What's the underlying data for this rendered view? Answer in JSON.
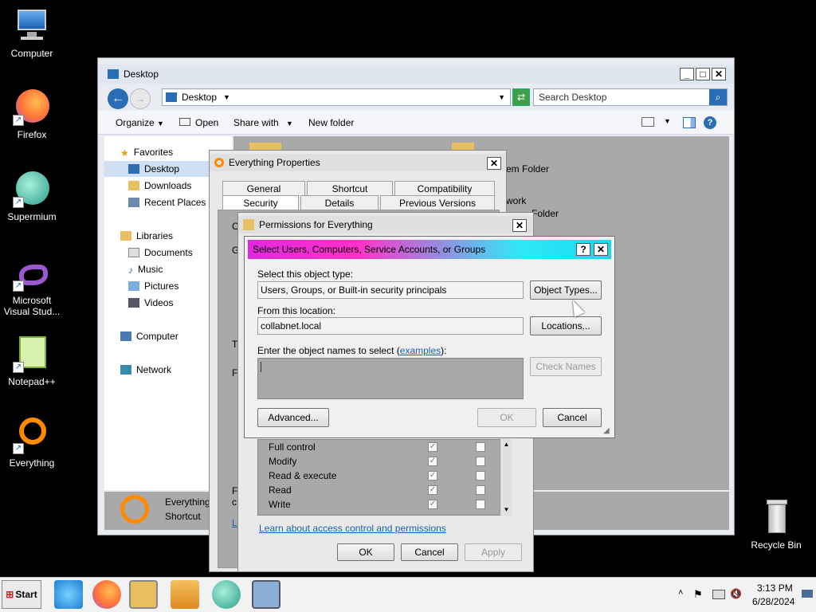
{
  "desktop": {
    "icons": [
      {
        "label": "Computer"
      },
      {
        "label": "Firefox"
      },
      {
        "label": "Supermium"
      },
      {
        "label": "Microsoft Visual Stud..."
      },
      {
        "label": "Notepad++"
      },
      {
        "label": "Everything"
      },
      {
        "label": "Recycle Bin"
      }
    ]
  },
  "explorer": {
    "title": "Desktop",
    "address": "Desktop",
    "search_placeholder": "Search Desktop",
    "toolbar": {
      "organize": "Organize",
      "open": "Open",
      "share_with": "Share with",
      "new_folder": "New folder"
    },
    "nav": {
      "favorites": "Favorites",
      "fav_items": [
        "Desktop",
        "Downloads",
        "Recent Places"
      ],
      "libraries": "Libraries",
      "lib_items": [
        "Documents",
        "Music",
        "Pictures",
        "Videos"
      ],
      "computer": "Computer",
      "network": "Network"
    },
    "content_fragments": [
      "em Folder",
      "work",
      "Folder"
    ],
    "details_name": "Everything",
    "details_type": "Shortcut"
  },
  "properties": {
    "title": "Everything Properties",
    "tabs_row1": [
      "General",
      "Shortcut",
      "Compatibility"
    ],
    "tabs_row2": [
      "Security",
      "Details",
      "Previous Versions"
    ],
    "frag_c": "C",
    "frag_g": "G",
    "frag_t": "T",
    "frag_f": "F",
    "frag_f2": "F",
    "frag_c2": "c",
    "frag_l": "L"
  },
  "permissions": {
    "title": "Permissions for Everything",
    "rows": [
      {
        "name": "Full control",
        "allow": true,
        "deny": false
      },
      {
        "name": "Modify",
        "allow": true,
        "deny": false
      },
      {
        "name": "Read & execute",
        "allow": true,
        "deny": false
      },
      {
        "name": "Read",
        "allow": true,
        "deny": false
      },
      {
        "name": "Write",
        "allow": true,
        "deny": false
      }
    ],
    "learn_link": "Learn about access control and permissions",
    "ok": "OK",
    "cancel": "Cancel",
    "apply": "Apply"
  },
  "select_dialog": {
    "title": "Select Users, Computers, Service Accounts, or Groups",
    "help": "?",
    "object_type_label": "Select this object type:",
    "object_type_value": "Users, Groups, or Built-in security principals",
    "object_types_button": "Object Types...",
    "location_label": "From this location:",
    "location_value": "collabnet.local",
    "locations_button": "Locations...",
    "names_label_pre": "Enter the object names to select (",
    "names_label_link": "examples",
    "names_label_post": "):",
    "check_names_button": "Check Names",
    "advanced_button": "Advanced...",
    "ok_button": "OK",
    "cancel_button": "Cancel"
  },
  "taskbar": {
    "start": "Start",
    "time": "3:13 PM",
    "date": "6/28/2024"
  }
}
